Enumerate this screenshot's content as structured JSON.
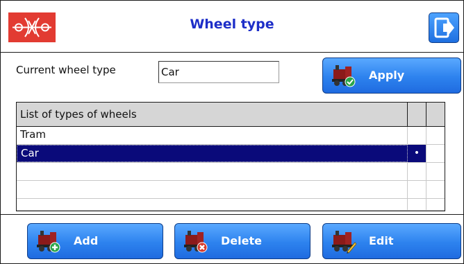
{
  "header": {
    "title": "Wheel type"
  },
  "current": {
    "label": "Current wheel type",
    "value": "Car"
  },
  "buttons": {
    "apply": "Apply",
    "add": "Add",
    "delete": "Delete",
    "edit": "Edit"
  },
  "table": {
    "header": "List of types of wheels",
    "rows": [
      {
        "name": "Tram",
        "mark": ""
      },
      {
        "name": "Car",
        "mark": "•",
        "selected": true
      }
    ]
  },
  "colors": {
    "logo_bg": "#e23b32",
    "title": "#1d2ec8",
    "button_blue": "#2d82ee",
    "selection": "#0a0a7a"
  },
  "icons": {
    "logo": "wheel-logo-icon",
    "exit": "exit-icon",
    "apply": "train-check-icon",
    "add": "train-add-icon",
    "delete": "train-delete-icon",
    "edit": "train-edit-icon"
  }
}
